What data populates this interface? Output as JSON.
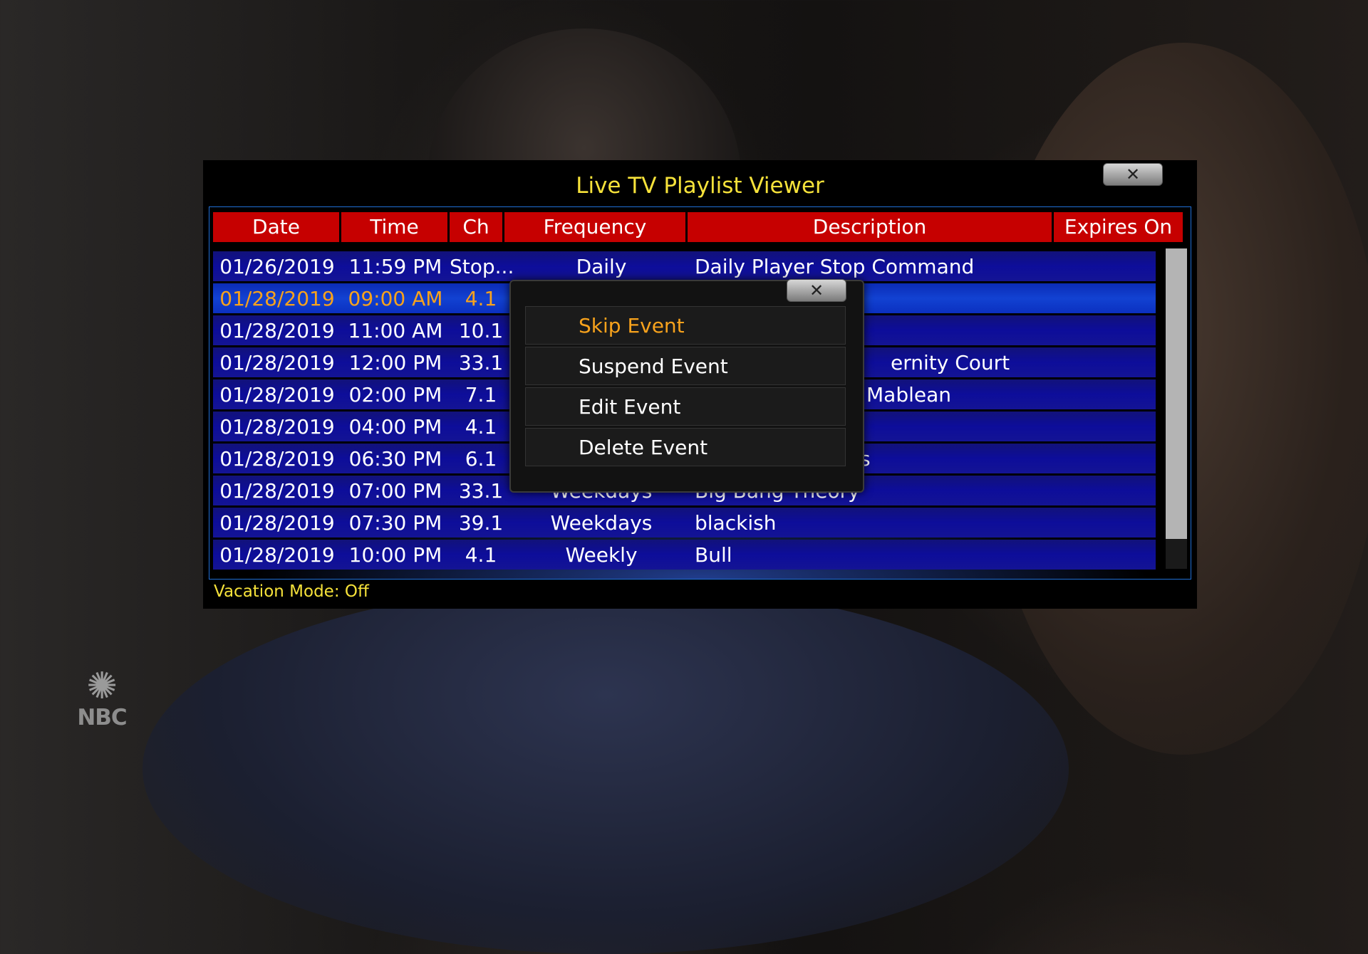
{
  "watermark": {
    "text": "NBC",
    "icon": "nbc-peacock-logo"
  },
  "viewer": {
    "title": "Live TV Playlist Viewer",
    "close_label": "✕",
    "columns": [
      "Date",
      "Time",
      "Ch",
      "Frequency",
      "Description",
      "Expires On"
    ],
    "rows": [
      {
        "date": "01/26/2019",
        "time": "11:59 PM",
        "ch": "Stop...",
        "freq": "Daily",
        "desc": "Daily Player Stop Command"
      },
      {
        "date": "01/28/2019",
        "time": "09:00 AM",
        "ch": "4.1",
        "freq": "",
        "desc": ""
      },
      {
        "date": "01/28/2019",
        "time": "11:00 AM",
        "ch": "10.1",
        "freq": "",
        "desc": ""
      },
      {
        "date": "01/28/2019",
        "time": "12:00 PM",
        "ch": "33.1",
        "freq": "",
        "desc": "ernity Court"
      },
      {
        "date": "01/28/2019",
        "time": "02:00 PM",
        "ch": "7.1",
        "freq": "",
        "desc": "Mablean"
      },
      {
        "date": "01/28/2019",
        "time": "04:00 PM",
        "ch": "4.1",
        "freq": "",
        "desc": ""
      },
      {
        "date": "01/28/2019",
        "time": "06:30 PM",
        "ch": "6.1",
        "freq": "",
        "desc": "s"
      },
      {
        "date": "01/28/2019",
        "time": "07:00 PM",
        "ch": "33.1",
        "freq": "Weekdays",
        "desc": "Big Bang Theory"
      },
      {
        "date": "01/28/2019",
        "time": "07:30 PM",
        "ch": "39.1",
        "freq": "Weekdays",
        "desc": "blackish"
      },
      {
        "date": "01/28/2019",
        "time": "10:00 PM",
        "ch": "4.1",
        "freq": "Weekly",
        "desc": "Bull"
      }
    ],
    "selected_row": 1,
    "vacation_mode": "Vacation Mode: Off"
  },
  "context_menu": {
    "close_label": "✕",
    "items": [
      "Skip Event",
      "Suspend Event",
      "Edit Event",
      "Delete Event"
    ],
    "active_item": 0
  },
  "colors": {
    "title_yellow": "#f6e23a",
    "header_red": "#c60000",
    "row_blue": "#0d0d9a",
    "selected_orange": "#f7a21c"
  }
}
